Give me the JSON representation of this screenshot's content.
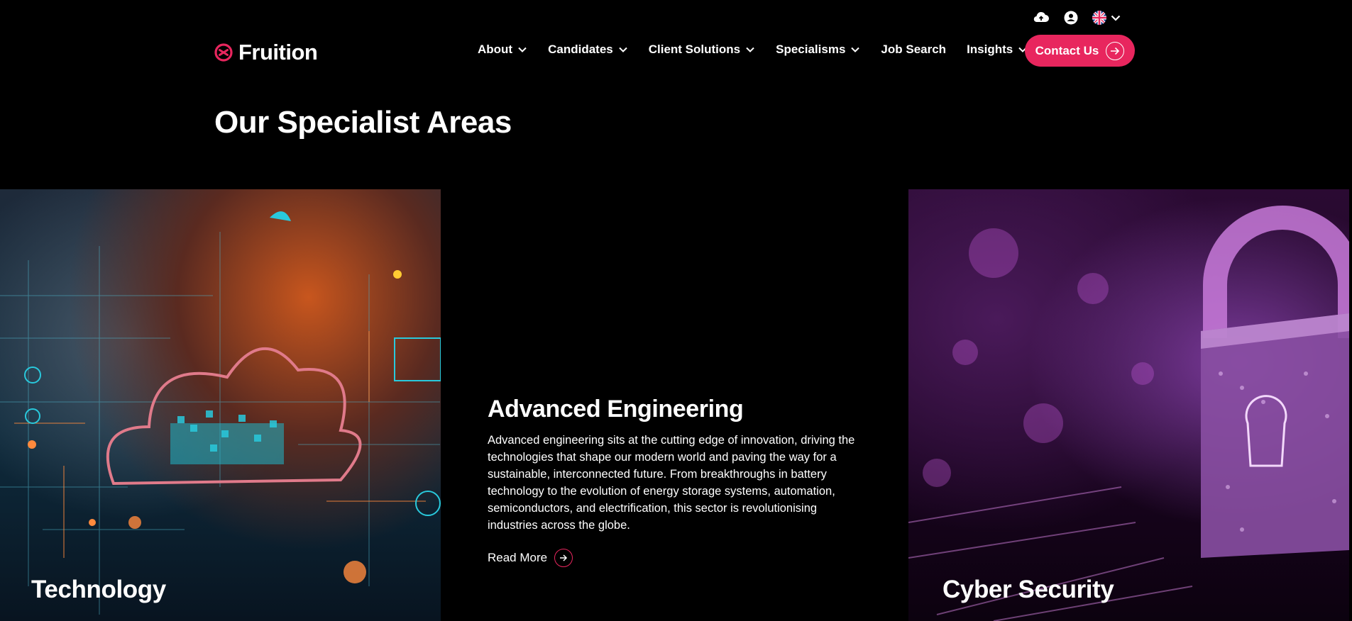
{
  "brand": {
    "name": "Fruition",
    "accent": "#e8265e"
  },
  "utility": {
    "icons": [
      "upload-cloud-icon",
      "user-account-icon",
      "uk-flag-icon",
      "chevron-down-icon"
    ]
  },
  "nav": {
    "items": [
      {
        "label": "About",
        "has_dropdown": true
      },
      {
        "label": "Candidates",
        "has_dropdown": true
      },
      {
        "label": "Client Solutions",
        "has_dropdown": true
      },
      {
        "label": "Specialisms",
        "has_dropdown": true
      },
      {
        "label": "Job Search",
        "has_dropdown": false
      },
      {
        "label": "Insights",
        "has_dropdown": true
      }
    ],
    "contact_label": "Contact Us"
  },
  "page": {
    "title": "Our Specialist Areas"
  },
  "tiles": {
    "technology": {
      "label": "Technology"
    },
    "advanced_engineering": {
      "title": "Advanced Engineering",
      "description": "Advanced engineering sits at the cutting edge of innovation, driving the technologies that shape our modern world and paving the way for a sustainable, interconnected future. From breakthroughs in battery technology to the evolution of energy storage systems, automation, semiconductors, and electrification, this sector is revolutionising industries across the globe.",
      "read_more": "Read More"
    },
    "cyber_security": {
      "label": "Cyber Security"
    }
  }
}
